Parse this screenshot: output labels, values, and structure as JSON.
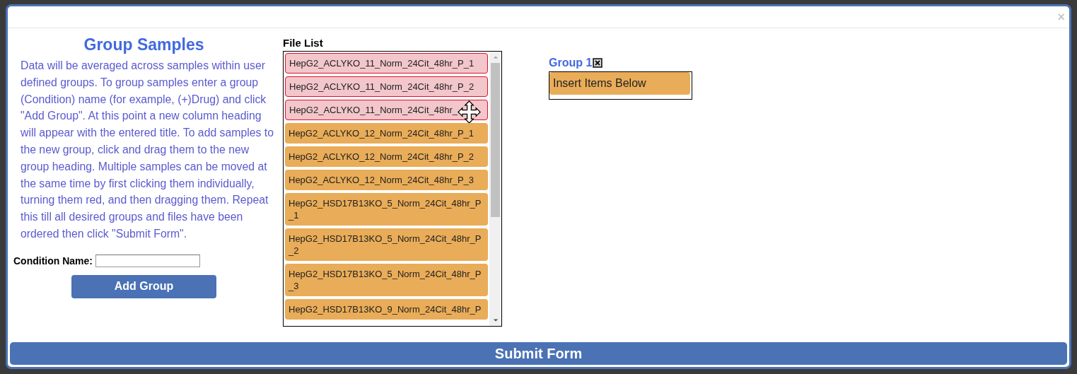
{
  "dialog": {
    "close": "×"
  },
  "intro": {
    "title": "Group Samples",
    "text": "Data will be averaged across samples within user defined groups. To group samples enter a group (Condition) name (for example, (+)Drug) and click \"Add Group\". At this point a new column heading will appear with the entered title. To add samples to the new group, click and drag them to the new group heading. Multiple samples can be moved at the same time by first clicking them individually, turning them red, and then dragging them. Repeat this till all desired groups and files have been ordered then click \"Submit Form\".",
    "field_label": "Condition Name:",
    "add_button": "Add Group"
  },
  "file_list": {
    "title": "File List",
    "items": [
      {
        "label": "HepG2_ACLYKO_11_Norm_24Cit_48hr_P_1",
        "selected": true
      },
      {
        "label": "HepG2_ACLYKO_11_Norm_24Cit_48hr_P_2",
        "selected": true
      },
      {
        "label": "HepG2_ACLYKO_11_Norm_24Cit_48hr_",
        "selected": true,
        "cursor": true
      },
      {
        "label": "HepG2_ACLYKO_12_Norm_24Cit_48hr_P_1",
        "selected": false
      },
      {
        "label": "HepG2_ACLYKO_12_Norm_24Cit_48hr_P_2",
        "selected": false
      },
      {
        "label": "HepG2_ACLYKO_12_Norm_24Cit_48hr_P_3",
        "selected": false
      },
      {
        "label": "HepG2_HSD17B13KO_5_Norm_24Cit_48hr_P_1",
        "selected": false
      },
      {
        "label": "HepG2_HSD17B13KO_5_Norm_24Cit_48hr_P_2",
        "selected": false
      },
      {
        "label": "HepG2_HSD17B13KO_5_Norm_24Cit_48hr_P_3",
        "selected": false
      },
      {
        "label": "HepG2_HSD17B13KO_9_Norm_24Cit_48hr_P",
        "selected": false
      }
    ]
  },
  "groups": [
    {
      "title": "Group 1",
      "placeholder": "Insert Items Below"
    }
  ],
  "submit_button": "Submit Form"
}
